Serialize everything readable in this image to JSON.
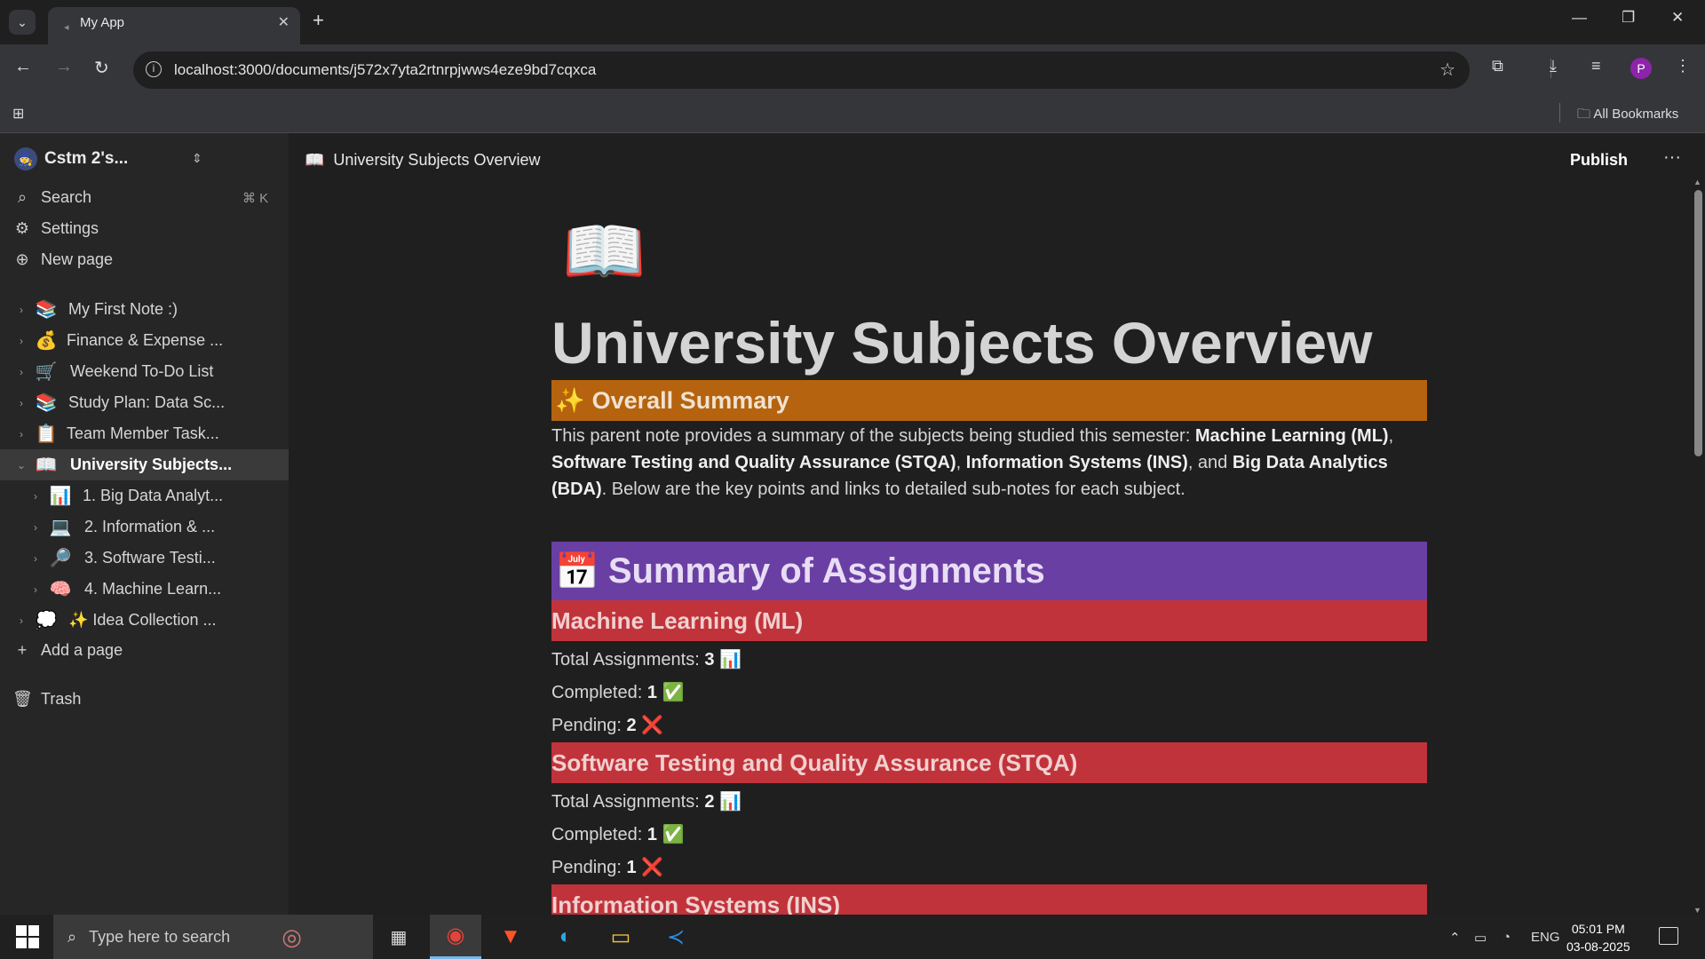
{
  "browser": {
    "tab_title": "My App",
    "url": "localhost:3000/documents/j572x7yta2rtnrpjwws4eze9bd7cqxca",
    "all_bookmarks": "All Bookmarks",
    "profile_initial": "P"
  },
  "sidebar": {
    "workspace": "Cstm 2's...",
    "search_label": "Search",
    "search_shortcut": "⌘ K",
    "settings_label": "Settings",
    "new_page_label": "New page",
    "pages": [
      {
        "emoji": "📚",
        "label": "My First Note :)"
      },
      {
        "emoji": "💰",
        "label": "Finance & Expense ..."
      },
      {
        "emoji": "🛒",
        "label": "Weekend To-Do List"
      },
      {
        "emoji": "📚",
        "label": "Study Plan: Data Sc..."
      },
      {
        "emoji": "📋",
        "label": "Team Member Task..."
      },
      {
        "emoji": "📖",
        "label": "University Subjects..."
      },
      {
        "emoji": "📊",
        "label": "1. Big Data Analyt..."
      },
      {
        "emoji": "💻",
        "label": "2. Information & ..."
      },
      {
        "emoji": "🔎",
        "label": "3. Software Testi..."
      },
      {
        "emoji": "🧠",
        "label": "4. Machine Learn..."
      },
      {
        "emoji": "💭",
        "label": "✨ Idea Collection ..."
      }
    ],
    "add_page_label": "Add a page",
    "trash_label": "Trash"
  },
  "header": {
    "breadcrumb_emoji": "📖",
    "breadcrumb_title": "University Subjects Overview",
    "publish_label": "Publish"
  },
  "document": {
    "icon": "📖",
    "title": "University Subjects Overview",
    "summary_heading_emoji": "✨",
    "summary_heading": "Overall Summary",
    "summary_p1": "This parent note provides a summary of the subjects being studied this semester: ",
    "summary_b1": "Machine Learning (ML)",
    "summary_s1": ", ",
    "summary_b2": "Software Testing and Quality Assurance (STQA)",
    "summary_s2": ", ",
    "summary_b3": "Information Systems (INS)",
    "summary_s3": ", and ",
    "summary_b4": "Big Data Analytics (BDA)",
    "summary_p2": ". Below are the key points and links to detailed sub-notes for each subject.",
    "assign_heading_emoji": "📅",
    "assign_heading": "Summary of Assignments",
    "subjects": [
      {
        "name": "Machine Learning (ML)",
        "total_label": "Total Assignments:",
        "total": "3",
        "total_emoji": "📊",
        "completed_label": "Completed:",
        "completed": "1",
        "completed_emoji": "✅",
        "pending_label": "Pending:",
        "pending": "2",
        "pending_emoji": "❌"
      },
      {
        "name": "Software Testing and Quality Assurance (STQA)",
        "total_label": "Total Assignments:",
        "total": "2",
        "total_emoji": "📊",
        "completed_label": "Completed:",
        "completed": "1",
        "completed_emoji": "✅",
        "pending_label": "Pending:",
        "pending": "1",
        "pending_emoji": "❌"
      },
      {
        "name": "Information Systems (INS)"
      }
    ]
  },
  "taskbar": {
    "search_placeholder": "Type here to search",
    "lang": "ENG",
    "time": "05:01 PM",
    "date": "03-08-2025"
  }
}
